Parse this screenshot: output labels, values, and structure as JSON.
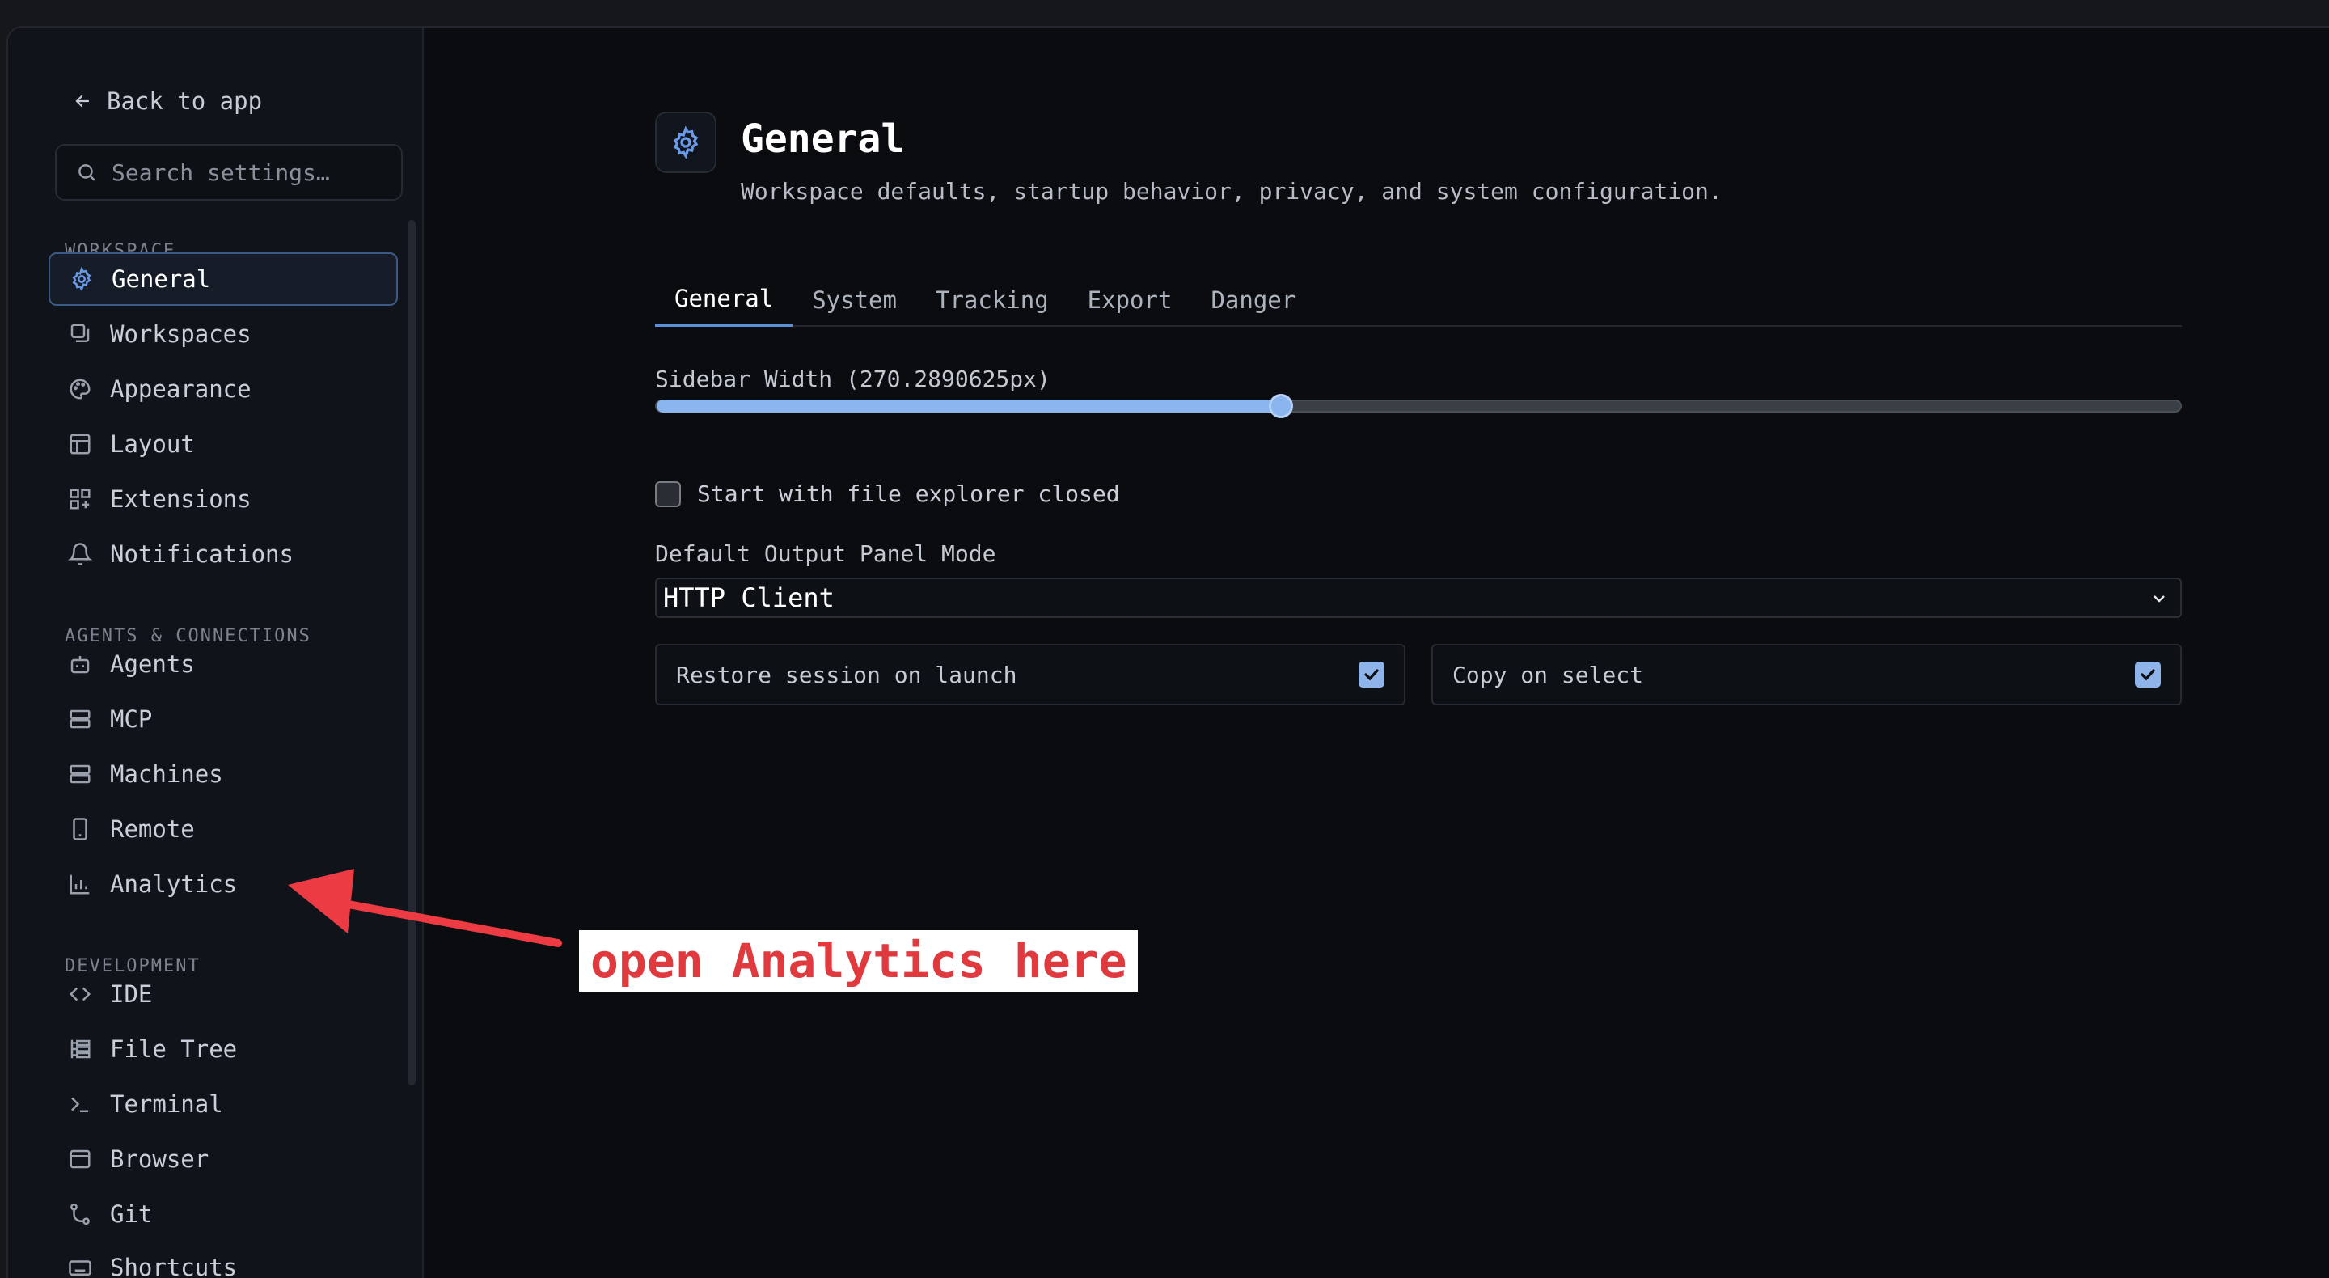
{
  "sidebar": {
    "back_label": "Back to app",
    "search_placeholder": "Search settings…",
    "sections": [
      {
        "label": "WORKSPACE"
      },
      {
        "label": "AGENTS & CONNECTIONS"
      },
      {
        "label": "DEVELOPMENT"
      }
    ],
    "items": [
      {
        "label": "General",
        "icon": "gear-icon",
        "active": true
      },
      {
        "label": "Workspaces",
        "icon": "workspaces-icon"
      },
      {
        "label": "Appearance",
        "icon": "palette-icon"
      },
      {
        "label": "Layout",
        "icon": "layout-icon"
      },
      {
        "label": "Extensions",
        "icon": "extensions-icon"
      },
      {
        "label": "Notifications",
        "icon": "bell-icon"
      },
      {
        "label": "Agents",
        "icon": "bot-icon"
      },
      {
        "label": "MCP",
        "icon": "server-icon"
      },
      {
        "label": "Machines",
        "icon": "machines-icon"
      },
      {
        "label": "Remote",
        "icon": "phone-icon"
      },
      {
        "label": "Analytics",
        "icon": "bar-chart-icon"
      },
      {
        "label": "IDE",
        "icon": "code-icon"
      },
      {
        "label": "File Tree",
        "icon": "file-tree-icon"
      },
      {
        "label": "Terminal",
        "icon": "terminal-icon"
      },
      {
        "label": "Browser",
        "icon": "browser-icon"
      },
      {
        "label": "Git",
        "icon": "git-icon"
      },
      {
        "label": "Shortcuts",
        "icon": "keyboard-icon"
      }
    ]
  },
  "header": {
    "title": "General",
    "subtitle": "Workspace defaults, startup behavior, privacy, and system configuration."
  },
  "tabs": [
    {
      "label": "General",
      "active": true
    },
    {
      "label": "System"
    },
    {
      "label": "Tracking"
    },
    {
      "label": "Export"
    },
    {
      "label": "Danger"
    }
  ],
  "settings": {
    "sidebar_width_label": "Sidebar Width (270.2890625px)",
    "sidebar_width_fraction": 0.41,
    "file_explorer_label": "Start with file explorer closed",
    "file_explorer_checked": false,
    "output_mode_label": "Default Output Panel Mode",
    "output_mode_value": "HTTP Client",
    "restore_session_label": "Restore session on launch",
    "restore_session_checked": true,
    "copy_on_select_label": "Copy on select",
    "copy_on_select_checked": true
  },
  "annotation": {
    "text": "open Analytics here",
    "color": "#e03a3e"
  },
  "colors": {
    "accent": "#8bb5ef",
    "active_border": "#3c5a86"
  }
}
